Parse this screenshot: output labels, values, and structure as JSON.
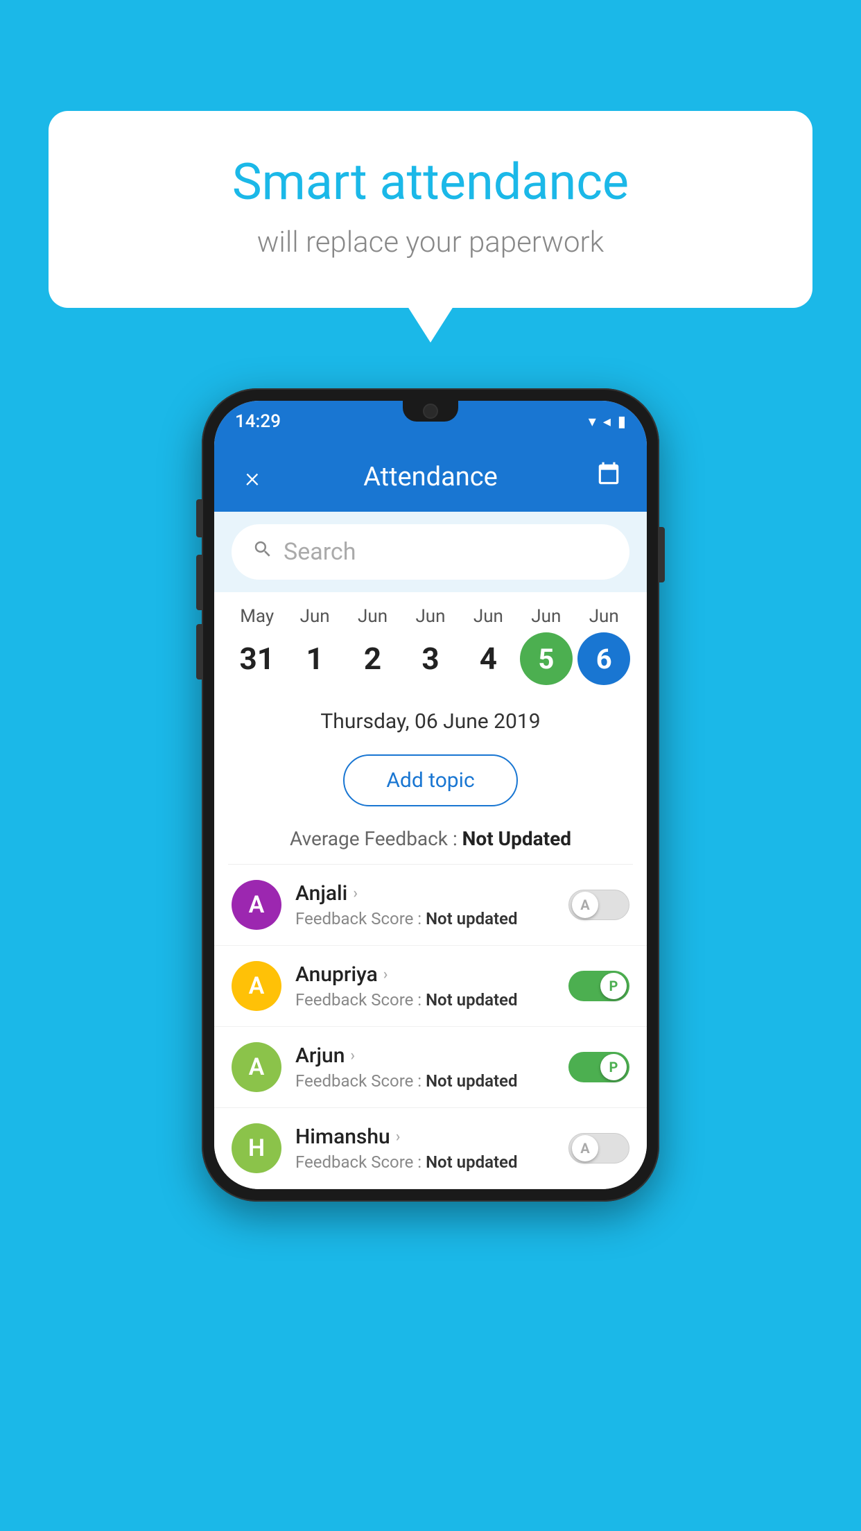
{
  "background_color": "#1BB8E8",
  "bubble": {
    "title": "Smart attendance",
    "subtitle": "will replace your paperwork"
  },
  "app": {
    "status_time": "14:29",
    "title": "Attendance",
    "close_label": "×",
    "search_placeholder": "Search",
    "selected_date_label": "Thursday, 06 June 2019",
    "add_topic_label": "Add topic",
    "feedback_prefix": "Average Feedback : ",
    "feedback_value": "Not Updated"
  },
  "calendar": {
    "days": [
      {
        "month": "May",
        "number": "31",
        "state": "normal"
      },
      {
        "month": "Jun",
        "number": "1",
        "state": "normal"
      },
      {
        "month": "Jun",
        "number": "2",
        "state": "normal"
      },
      {
        "month": "Jun",
        "number": "3",
        "state": "normal"
      },
      {
        "month": "Jun",
        "number": "4",
        "state": "normal"
      },
      {
        "month": "Jun",
        "number": "5",
        "state": "today"
      },
      {
        "month": "Jun",
        "number": "6",
        "state": "selected"
      }
    ]
  },
  "students": [
    {
      "name": "Anjali",
      "avatar_letter": "A",
      "avatar_color": "#9C27B0",
      "feedback_label": "Feedback Score : ",
      "feedback_value": "Not updated",
      "toggle_state": "off",
      "toggle_label": "A"
    },
    {
      "name": "Anupriya",
      "avatar_letter": "A",
      "avatar_color": "#FFC107",
      "feedback_label": "Feedback Score : ",
      "feedback_value": "Not updated",
      "toggle_state": "on",
      "toggle_label": "P"
    },
    {
      "name": "Arjun",
      "avatar_letter": "A",
      "avatar_color": "#8BC34A",
      "feedback_label": "Feedback Score : ",
      "feedback_value": "Not updated",
      "toggle_state": "on",
      "toggle_label": "P"
    },
    {
      "name": "Himanshu",
      "avatar_letter": "H",
      "avatar_color": "#8BC34A",
      "feedback_label": "Feedback Score : ",
      "feedback_value": "Not updated",
      "toggle_state": "off",
      "toggle_label": "A"
    }
  ]
}
